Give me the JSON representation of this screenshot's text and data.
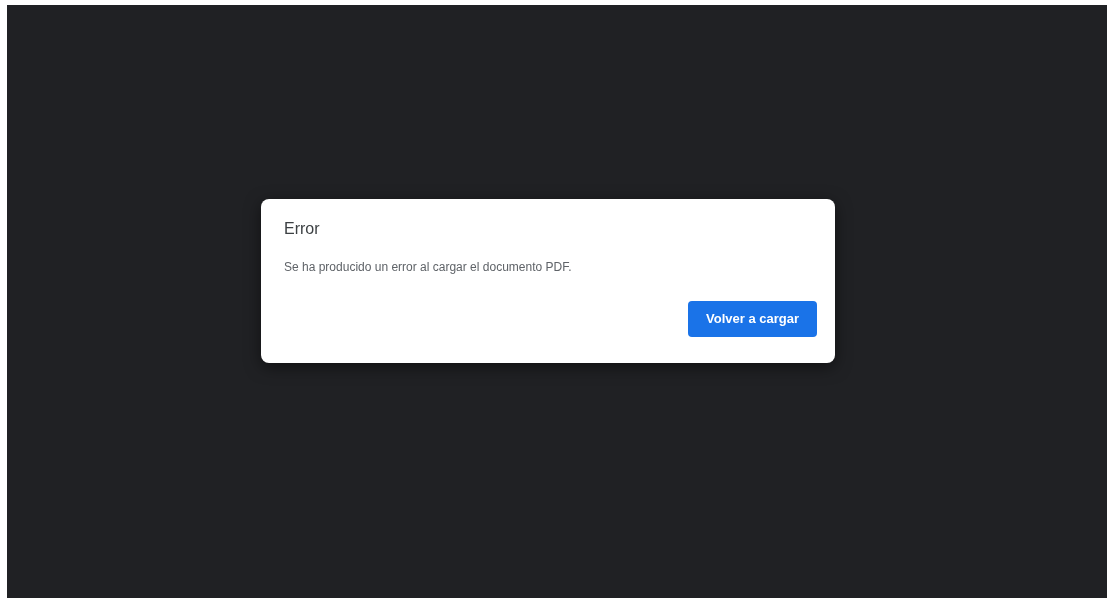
{
  "dialog": {
    "title": "Error",
    "message": "Se ha producido un error al cargar el documento PDF.",
    "buttons": [
      "Volver a cargar"
    ]
  }
}
